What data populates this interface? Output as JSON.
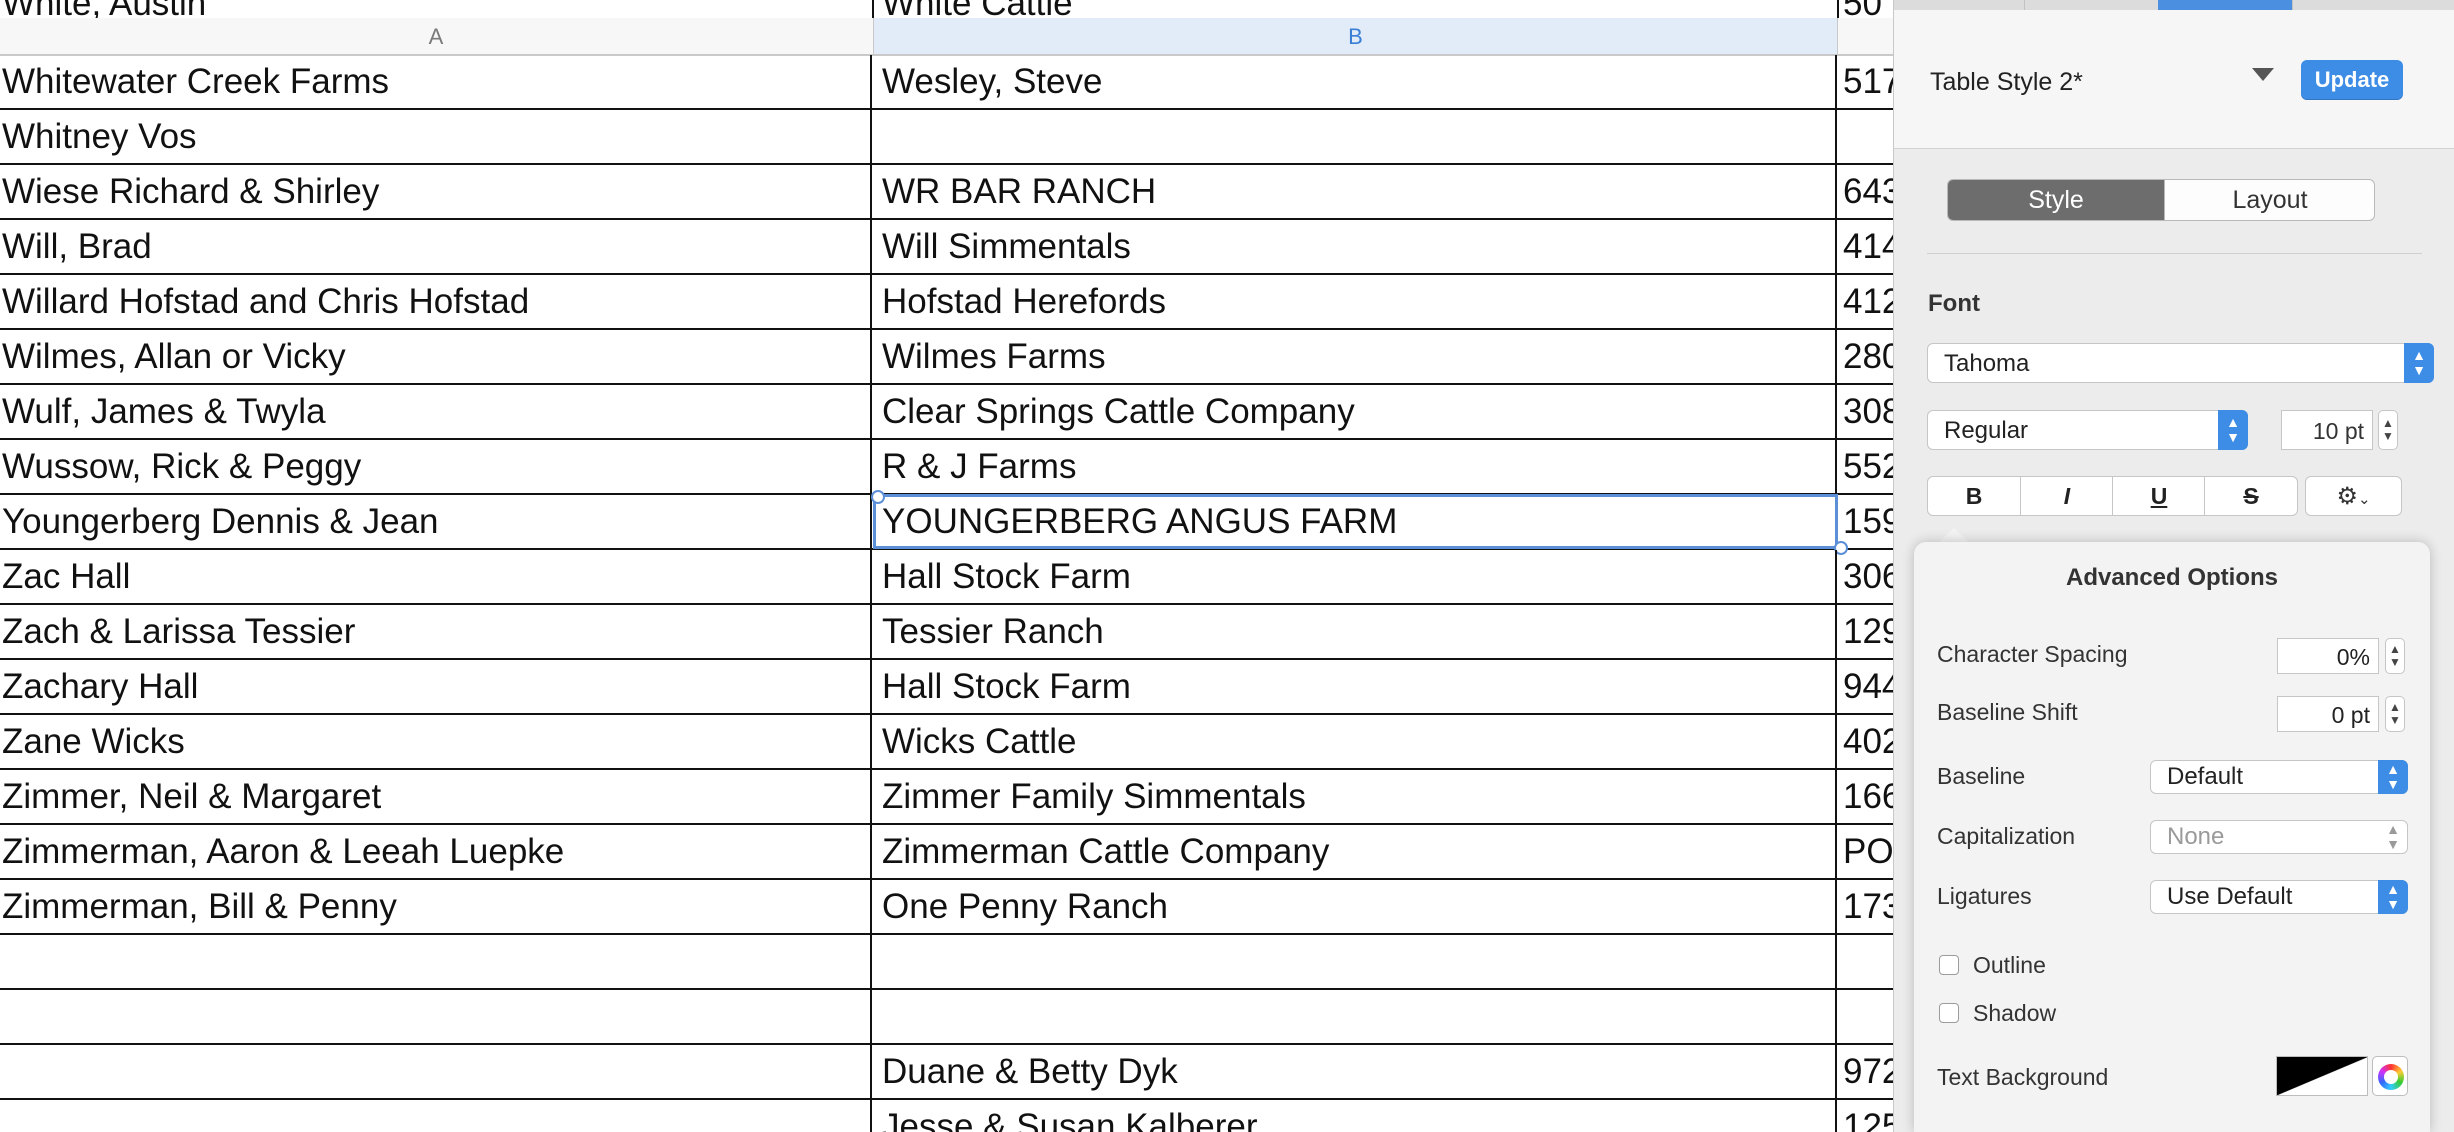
{
  "sheet": {
    "partial_top_row": {
      "a": "White, Austin",
      "b": "White Cattle",
      "c": "50"
    },
    "columns": [
      "A",
      "B"
    ],
    "rows": [
      {
        "a": "Whitewater Creek Farms",
        "b": "Wesley, Steve",
        "c": "517"
      },
      {
        "a": "Whitney Vos",
        "b": "",
        "c": ""
      },
      {
        "a": "Wiese Richard & Shirley",
        "b": "WR BAR RANCH",
        "c": "643"
      },
      {
        "a": "Will, Brad",
        "b": "Will Simmentals",
        "c": "414"
      },
      {
        "a": "Willard Hofstad and Chris Hofstad",
        "b": "Hofstad Herefords",
        "c": "412"
      },
      {
        "a": "Wilmes, Allan or Vicky",
        "b": "Wilmes Farms",
        "c": "280"
      },
      {
        "a": "Wulf, James & Twyla",
        "b": "Clear Springs Cattle Company",
        "c": "308"
      },
      {
        "a": "Wussow, Rick & Peggy",
        "b": "R & J Farms",
        "c": "552"
      },
      {
        "a": "Youngerberg Dennis & Jean",
        "b": "YOUNGERBERG ANGUS FARM",
        "c": "159"
      },
      {
        "a": "Zac Hall",
        "b": "Hall Stock Farm",
        "c": "306"
      },
      {
        "a": "Zach & Larissa Tessier",
        "b": "Tessier Ranch",
        "c": "129"
      },
      {
        "a": "Zachary Hall",
        "b": "Hall Stock Farm",
        "c": "944"
      },
      {
        "a": "Zane Wicks",
        "b": "Wicks Cattle",
        "c": "402"
      },
      {
        "a": "Zimmer, Neil & Margaret",
        "b": "Zimmer Family Simmentals",
        "c": "166"
      },
      {
        "a": "Zimmerman, Aaron & Leeah Luepke",
        "b": "Zimmerman Cattle Company",
        "c": "PO"
      },
      {
        "a": "Zimmerman, Bill & Penny",
        "b": "One Penny Ranch",
        "c": "173"
      },
      {
        "a": "",
        "b": "",
        "c": ""
      },
      {
        "a": "",
        "b": "",
        "c": ""
      },
      {
        "a": "",
        "b": "Duane & Betty Dyk",
        "c": "972"
      },
      {
        "a": "",
        "b": "Jesse & Susan Kalberer",
        "c": "125"
      }
    ]
  },
  "inspector": {
    "table_style_name": "Table Style 2*",
    "update_label": "Update",
    "tabs": {
      "style": "Style",
      "layout": "Layout"
    },
    "font": {
      "section_label": "Font",
      "family": "Tahoma",
      "weight": "Regular",
      "size": "10 pt",
      "bold": "B",
      "italic": "I",
      "underline": "U",
      "strikethrough": "S"
    },
    "advanced": {
      "title": "Advanced Options",
      "character_spacing_label": "Character Spacing",
      "character_spacing_value": "0%",
      "baseline_shift_label": "Baseline Shift",
      "baseline_shift_value": "0 pt",
      "baseline_label": "Baseline",
      "baseline_value": "Default",
      "capitalization_label": "Capitalization",
      "capitalization_value": "None",
      "ligatures_label": "Ligatures",
      "ligatures_value": "Use Default",
      "outline_label": "Outline",
      "shadow_label": "Shadow",
      "text_background_label": "Text Background"
    },
    "colors": {
      "accent": "#3d8ce6",
      "selection": "#5b8fd8"
    }
  }
}
